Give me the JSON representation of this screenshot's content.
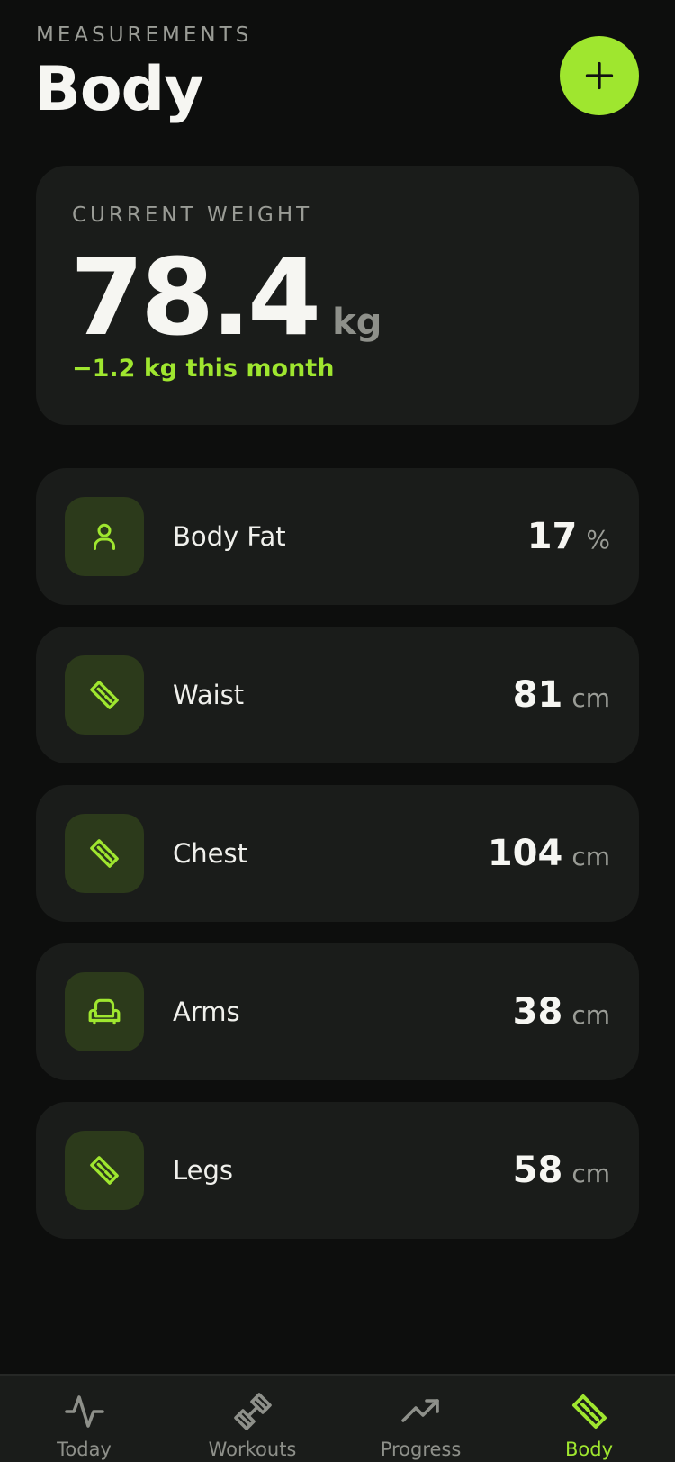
{
  "header": {
    "eyebrow": "MEASUREMENTS",
    "title": "Body",
    "add_icon": "plus-icon"
  },
  "weight": {
    "label": "CURRENT WEIGHT",
    "value": "78.4",
    "unit": "kg",
    "delta": "−1.2 kg this month"
  },
  "metrics": [
    {
      "name": "Body Fat",
      "value": "17",
      "unit": "%",
      "icon": "person-icon"
    },
    {
      "name": "Waist",
      "value": "81",
      "unit": "cm",
      "icon": "ruler-icon"
    },
    {
      "name": "Chest",
      "value": "104",
      "unit": "cm",
      "icon": "ruler-icon"
    },
    {
      "name": "Arms",
      "value": "38",
      "unit": "cm",
      "icon": "armchair-icon"
    },
    {
      "name": "Legs",
      "value": "58",
      "unit": "cm",
      "icon": "ruler-icon"
    }
  ],
  "tabs": [
    {
      "label": "Today",
      "icon": "activity-icon",
      "active": false
    },
    {
      "label": "Workouts",
      "icon": "dumbbell-icon",
      "active": false
    },
    {
      "label": "Progress",
      "icon": "trending-up-icon",
      "active": false
    },
    {
      "label": "Body",
      "icon": "ruler-icon",
      "active": true
    }
  ],
  "colors": {
    "accent": "#9fe62f",
    "background": "#0d0e0d",
    "card": "#1a1c1a",
    "icon_tile": "#2c3a1b"
  }
}
